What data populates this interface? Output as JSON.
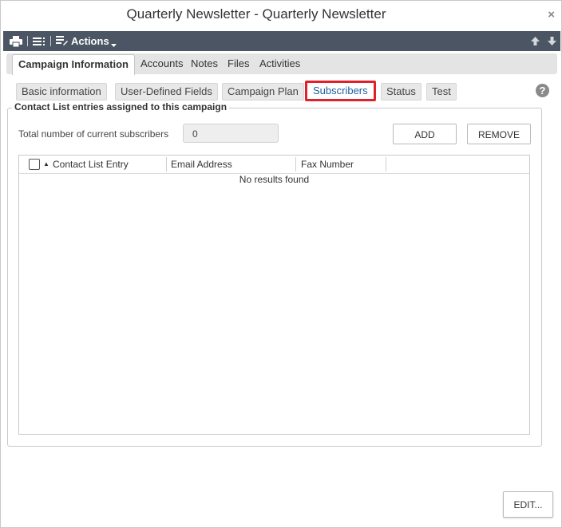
{
  "window": {
    "title": "Quarterly Newsletter - Quarterly Newsletter",
    "close_glyph": "×"
  },
  "toolbar": {
    "icons": [
      "print-icon",
      "list-icon",
      "list-edit-icon",
      "arrow-up-icon",
      "arrow-down-icon"
    ],
    "actions_label": "Actions"
  },
  "tabs": [
    {
      "label": "Campaign Information",
      "active": true
    },
    {
      "label": "Accounts"
    },
    {
      "label": "Notes"
    },
    {
      "label": "Files"
    },
    {
      "label": "Activities"
    }
  ],
  "subtabs": [
    {
      "label": "Basic information"
    },
    {
      "label": "User-Defined Fields"
    },
    {
      "label": "Campaign Plan"
    },
    {
      "label": "Subscribers",
      "active": true
    },
    {
      "label": "Status"
    },
    {
      "label": "Test"
    }
  ],
  "help_glyph": "?",
  "section": {
    "legend": "Contact List entries assigned to this campaign",
    "total_label": "Total number of current subscribers",
    "total_value": "0",
    "add_label": "ADD",
    "remove_label": "REMOVE"
  },
  "grid": {
    "columns": [
      "Contact List Entry",
      "Email Address",
      "Fax Number"
    ],
    "sort_glyph": "▲",
    "empty_message": "No results found"
  },
  "footer": {
    "edit_label": "EDIT..."
  },
  "colors": {
    "toolbar_bg": "#4b5563",
    "active_subtab_text": "#1f5fa0",
    "highlight_border": "#e0202a"
  }
}
